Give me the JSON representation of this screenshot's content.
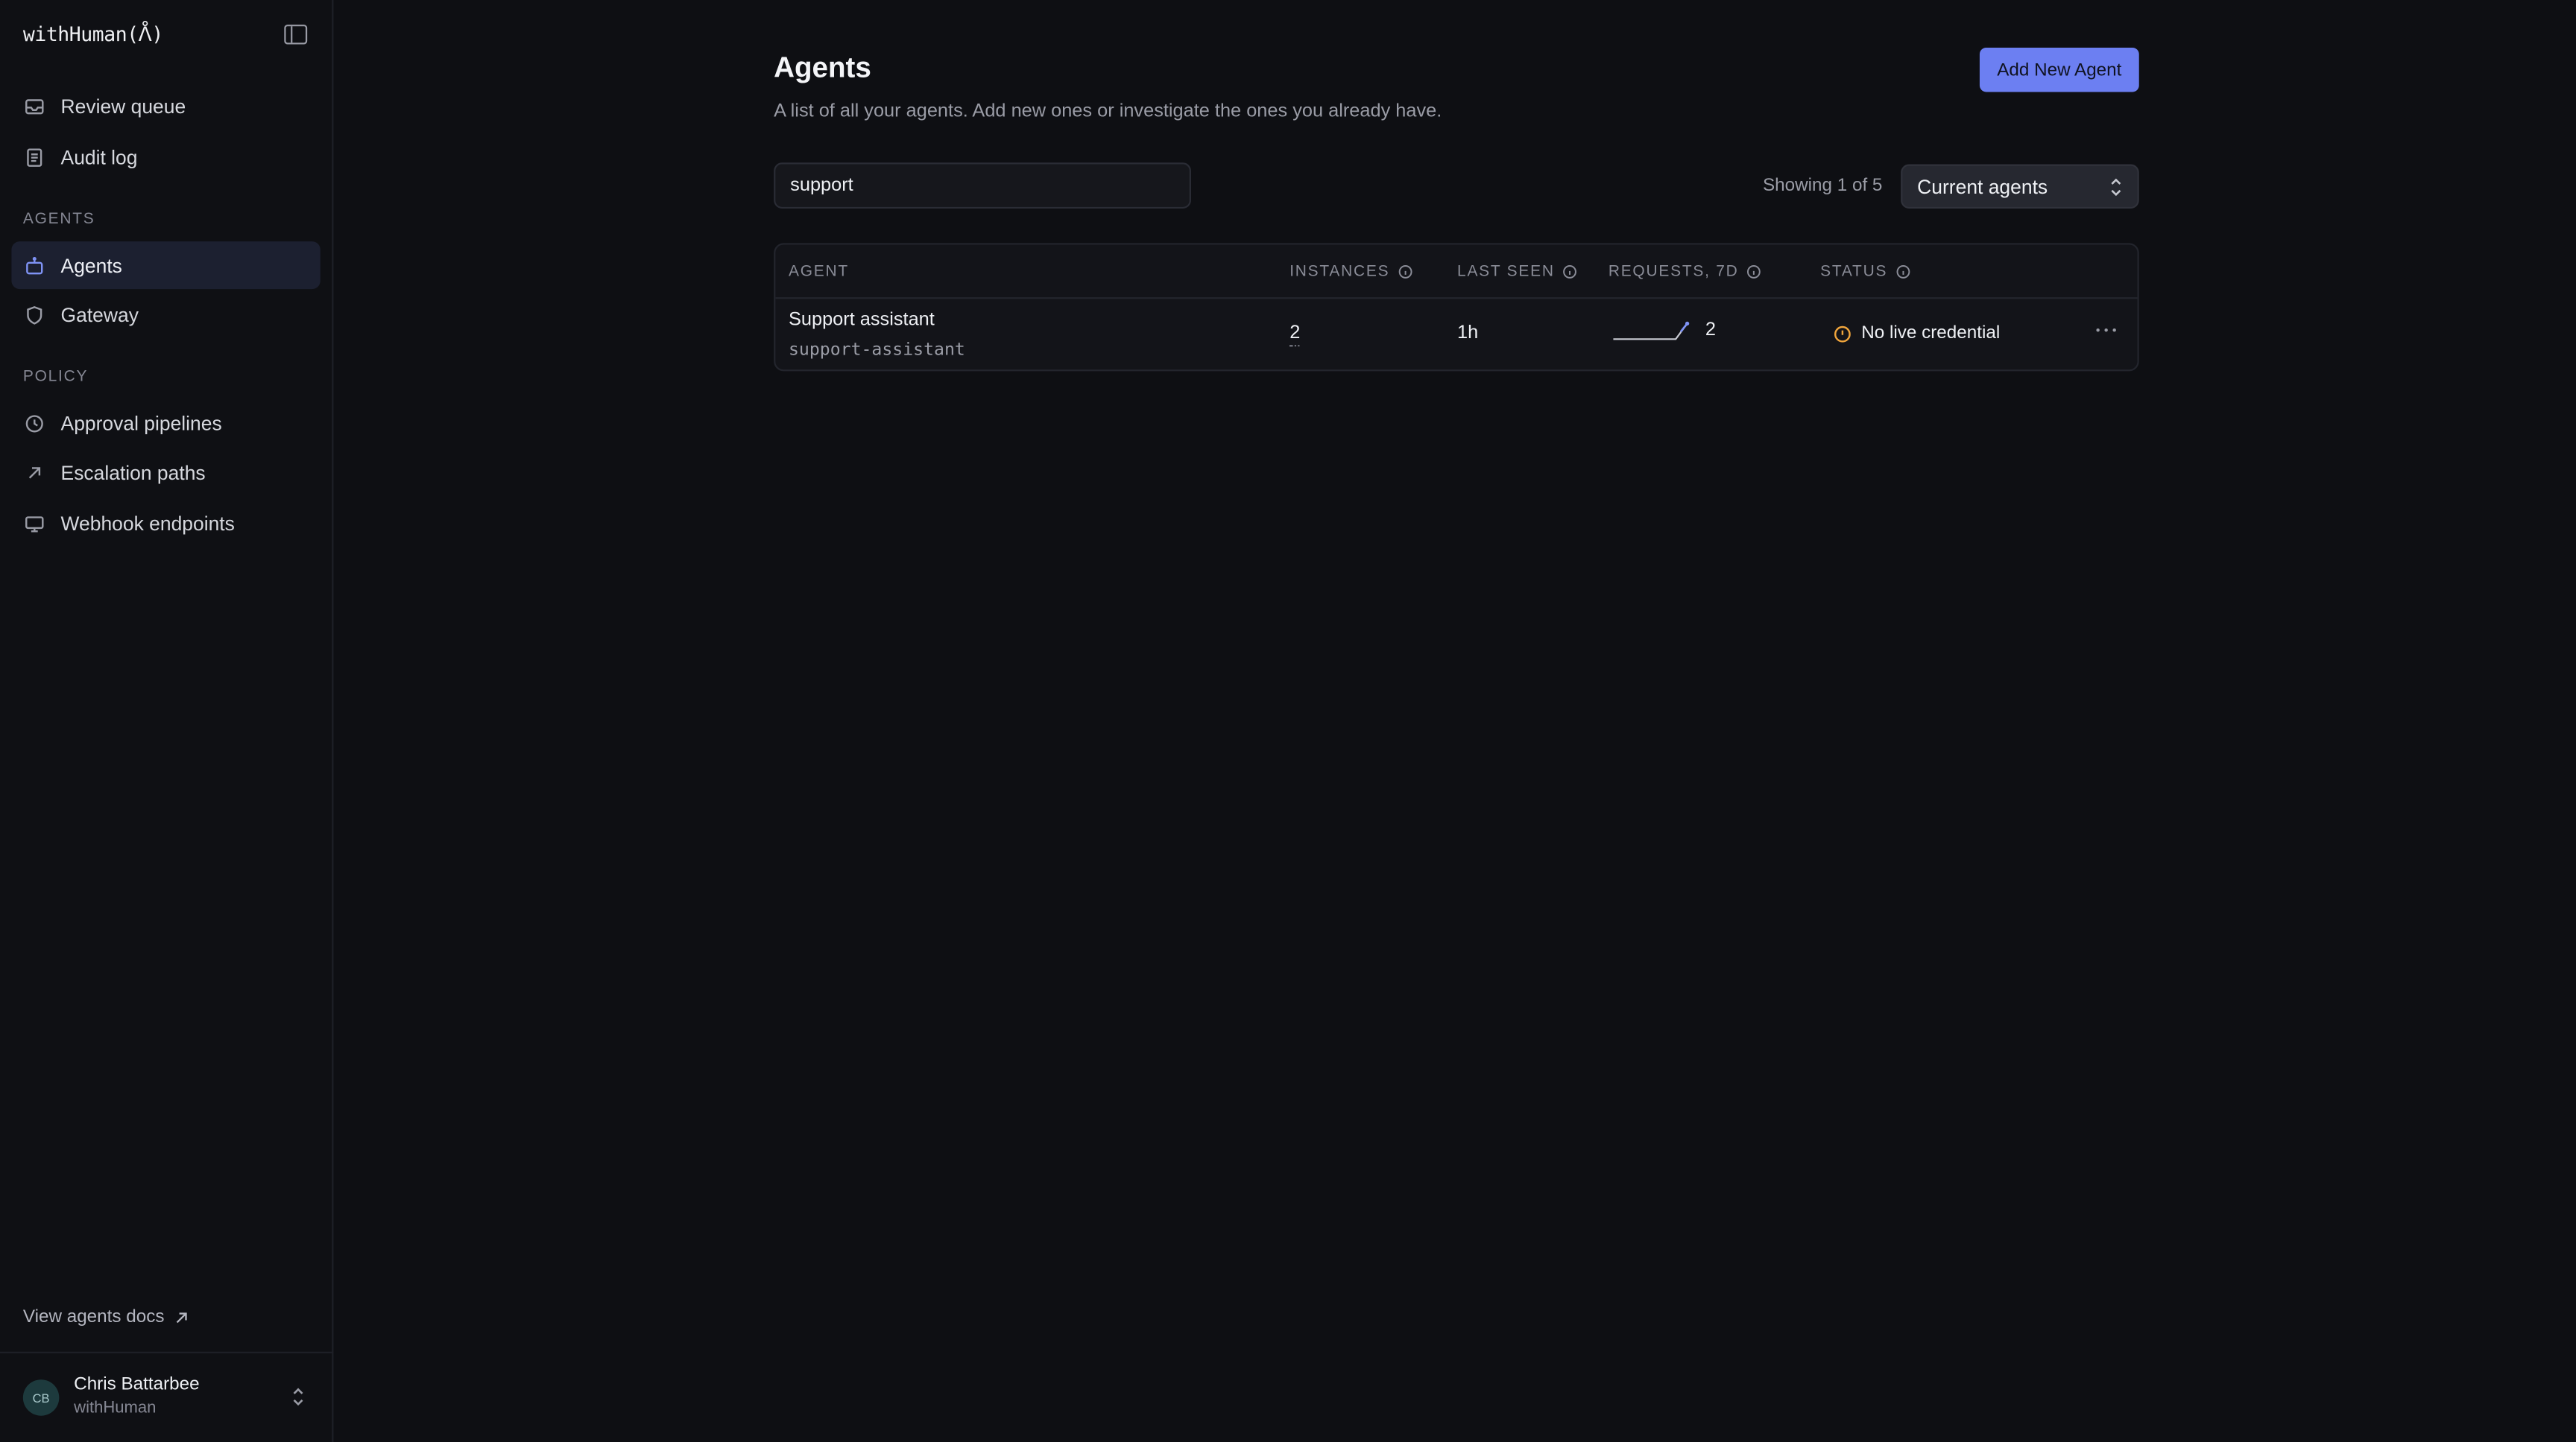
{
  "brand": "withHuman(ᐰ)",
  "sidebar": {
    "top_items": [
      {
        "label": "Review queue",
        "icon": "inbox-icon"
      },
      {
        "label": "Audit log",
        "icon": "document-icon"
      }
    ],
    "agents_section": "AGENTS",
    "agents_items": [
      {
        "label": "Agents",
        "icon": "bot-icon",
        "active": true
      },
      {
        "label": "Gateway",
        "icon": "shield-icon"
      }
    ],
    "policy_section": "POLICY",
    "policy_items": [
      {
        "label": "Approval pipelines",
        "icon": "clock-icon"
      },
      {
        "label": "Escalation paths",
        "icon": "arrow-up-right-icon"
      },
      {
        "label": "Webhook endpoints",
        "icon": "monitor-icon"
      }
    ],
    "docs_link": "View agents docs",
    "user": {
      "initials": "CB",
      "name": "Chris Battarbee",
      "org": "withHuman"
    }
  },
  "main": {
    "title": "Agents",
    "subtitle": "A list of all your agents. Add new ones or investigate the ones you already have.",
    "add_button": "Add New Agent",
    "search_value": "support",
    "showing": "Showing 1 of 5",
    "filter_selected": "Current agents",
    "table": {
      "headers": [
        "AGENT",
        "INSTANCES",
        "LAST SEEN",
        "REQUESTS, 7D",
        "STATUS"
      ],
      "rows": [
        {
          "name": "Support assistant",
          "slug": "support-assistant",
          "instances": "2",
          "last_seen": "1h",
          "requests_7d": "2",
          "status": "No live credential"
        }
      ]
    }
  },
  "colors": {
    "accent": "#6c7ff2",
    "warning": "#f0a53c",
    "sparkline": "#7f93f5"
  }
}
